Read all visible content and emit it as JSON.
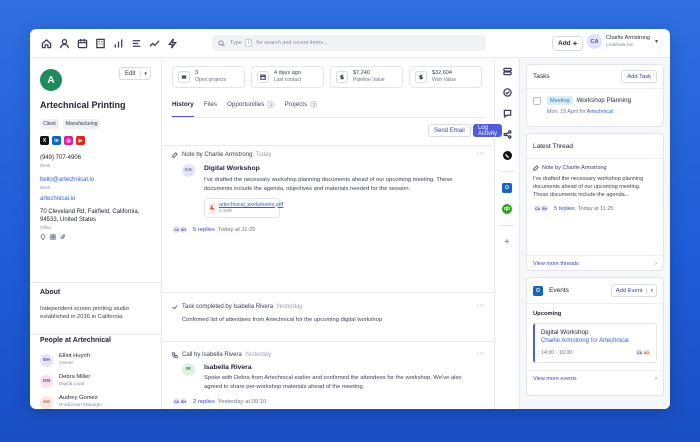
{
  "topbar": {
    "nav_icons": [
      "home-icon",
      "user-icon",
      "calendar-icon",
      "building-icon",
      "bar-chart-icon",
      "list-icon",
      "trend-icon",
      "bolt-icon"
    ],
    "search_kbd": "Type",
    "search_kbd2": "/",
    "search_placeholder": "for search and recent items...",
    "add_label": "Add",
    "add_plus": "+",
    "user_initials": "CA",
    "user_name": "Charlie Armstrong",
    "user_org": "Lookhark Inc"
  },
  "company": {
    "logo_letter": "A",
    "edit_label": "Edit",
    "name": "Artechnical Printing",
    "tags": [
      "Client",
      "Manufacturing"
    ],
    "socials": [
      {
        "label": "X",
        "color": "#111111"
      },
      {
        "label": "in",
        "color": "#0a66c2"
      },
      {
        "label": "◎",
        "color": "#d6249f"
      },
      {
        "label": "▶",
        "color": "#e62117"
      }
    ],
    "phone": "(949) 707-4906",
    "phone_label": "Work",
    "email": "hello@artechnical.io",
    "email_label": "Work",
    "website": "artechnical.io",
    "address_line1": "70 Cleveland Rd, Fairfield, California,",
    "address_line2": "94533, United States",
    "address_label": "Office",
    "about_title": "About",
    "about_text": "Independent screen printing studio established in 2016 in California.",
    "people_title": "People at Artechnical",
    "people": [
      {
        "initials": "EH",
        "name": "Elliot Huynh",
        "role": "Owner",
        "bg": "#e6e3f6",
        "fg": "#5a4fa8"
      },
      {
        "initials": "DM",
        "name": "Debra Miller",
        "role": "Digital Lead",
        "bg": "#f6e0ee",
        "fg": "#a8407a"
      },
      {
        "initials": "AG",
        "name": "Audrey Gomez",
        "role": "Production Manager",
        "bg": "#f7e6df",
        "fg": "#b0603a"
      }
    ]
  },
  "stats": [
    {
      "value": "3",
      "label": "Open projects",
      "icon": "layers-icon"
    },
    {
      "value": "4 days ago",
      "label": "Last contact",
      "icon": "calendar-icon"
    },
    {
      "value": "$7,240",
      "label": "Pipeline Value",
      "icon": "dollar-icon"
    },
    {
      "value": "$32,604",
      "label": "Won Value",
      "icon": "dollar-icon"
    }
  ],
  "tabs": [
    {
      "label": "History",
      "count": ""
    },
    {
      "label": "Files",
      "count": ""
    },
    {
      "label": "Opportunities",
      "count": "1"
    },
    {
      "label": "Projects",
      "count": "3"
    }
  ],
  "actions": {
    "send_email": "Send Email",
    "log_activity": "Log Activity"
  },
  "activities": {
    "note": {
      "head": "Note by Charlie Armstrong",
      "when": "Today",
      "avatar": "CA",
      "title": "Digital Workshop",
      "text": "I've drafted the necessary workshop planning documents ahead of our upcoming meeting. These documents include the agenda, objectives and materials needed for the session.",
      "file_name": "artechnical_worksheets.pdf",
      "file_size": "2.1MB",
      "reply_avatars": [
        "CA",
        "EH"
      ],
      "replies": "5 replies",
      "reply_when": "Today at 11:25"
    },
    "task": {
      "head": "Task completed by Isabella Rivera",
      "when": "Yesterday",
      "text": "Confirmed list of attendees from Artechnical for the upcoming digital workshop"
    },
    "call": {
      "head": "Call by Isabella Rivera",
      "when": "Yesterday",
      "avatar": "IR",
      "title": "Isabella Rivera",
      "text": "Spoke with Debra from Artechnical earlier and confirmed the attendees for the workshop. We've also agreed to share pre-workshop materials ahead of the meeting.",
      "reply_avatars": [
        "CA",
        "EH"
      ],
      "replies": "2 replies",
      "reply_when": "Yesterday at 09:10"
    },
    "more": "···"
  },
  "rail": {
    "icons": [
      "grid-icon",
      "check-circle-icon",
      "chat-icon",
      "share-icon",
      "phone-icon"
    ],
    "badges": [
      {
        "label": "O",
        "color": "#1565c0"
      },
      {
        "label": "qb",
        "color": "#2ca01c"
      }
    ],
    "add": "+"
  },
  "tasks_card": {
    "title": "Tasks",
    "add_label": "Add Task",
    "chip": "Meeting",
    "task_title": "Workshop Planning",
    "due": "Mon, 15 April",
    "for_word": "for",
    "for_org": "Artechnical"
  },
  "thread_card": {
    "title": "Latest Thread",
    "head": "Note by Charlie Armstrong",
    "text": "I've drafted the necessary workshop planning documents ahead of our upcoming meeting. These documents include the agenda...",
    "reply_avatars": [
      "CA",
      "EH"
    ],
    "replies": "5 replies",
    "reply_when": "Today at 11:25",
    "view_more": "View more threads",
    "chev": "›"
  },
  "events_card": {
    "icon_label": "O",
    "title": "Events",
    "add_label": "Add Event",
    "upcoming": "Upcoming",
    "event_title": "Digital Workshop",
    "event_person": "Charlie Armstrong",
    "event_for": "for",
    "event_org": "Artechnical",
    "event_time": "14:00 - 16:00",
    "event_avatars": [
      "CA",
      "AG"
    ],
    "view_more": "View more events",
    "chev": "›"
  },
  "colors": {
    "accent": "#4f5bdb",
    "link": "#2f5ed6",
    "background": "#2f6fe0",
    "logo": "#1f8a5c"
  }
}
